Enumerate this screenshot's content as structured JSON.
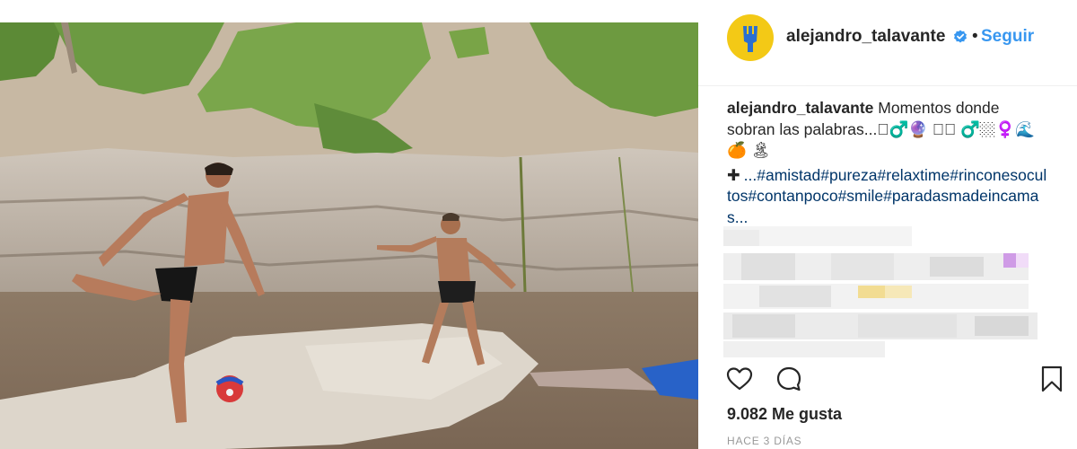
{
  "post": {
    "image_alt": "Two shirtless men playing football on a rocky beach",
    "header": {
      "username": "alejandro_talavante",
      "separator": "•",
      "follow_label": "Seguir"
    },
    "caption": {
      "username": "alejandro_talavante",
      "text": "Momentos donde sobran las palabras...🏻‍♂️🔮 🏻🏽 ♂️🏼‍♀️🌊 🍊 🏝",
      "more_symbol": "✚",
      "hashtags": "...#amistad#pureza#relaxtime#rinconesocultos#contanpoco#smile#paradasmadeincamas..."
    },
    "likes_text": "9.082 Me gusta",
    "timestamp": "HACE 3 DÍAS",
    "icons": {
      "verified": "verified-badge-icon",
      "like": "heart-icon",
      "comment": "comment-bubble-icon",
      "save": "bookmark-icon"
    },
    "colors": {
      "follow": "#3897f0",
      "verified": "#3897f0",
      "hashtag": "#003569",
      "timestamp": "#999999",
      "avatar": "#f3c916"
    }
  }
}
